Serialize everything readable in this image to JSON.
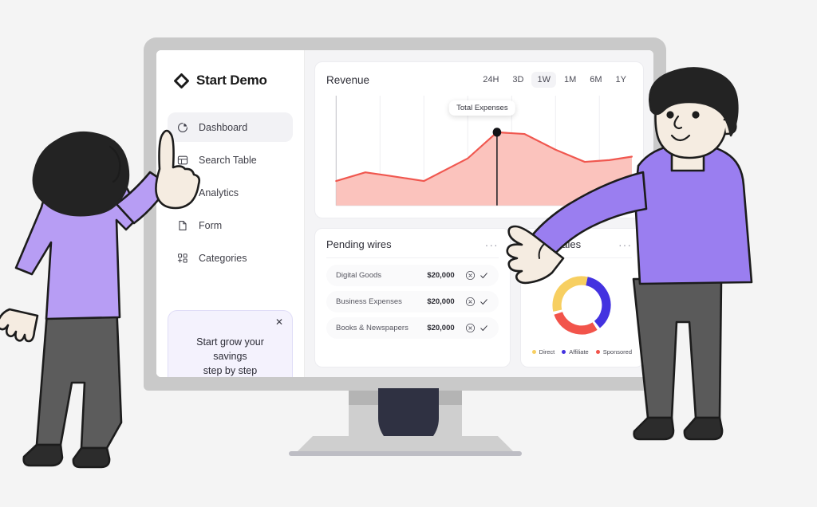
{
  "app": {
    "brand_name": "Start Demo",
    "brand_logo_icon": "diamond-outline-icon"
  },
  "sidebar": {
    "items": [
      {
        "label": "Dashboard",
        "icon": "pie-chart-icon",
        "active": true
      },
      {
        "label": "Search Table",
        "icon": "table-icon",
        "active": false
      },
      {
        "label": "Analytics",
        "icon": "bar-chart-icon",
        "active": false
      },
      {
        "label": "Form",
        "icon": "document-icon",
        "active": false
      },
      {
        "label": "Categories",
        "icon": "grid-plus-icon",
        "active": false
      }
    ],
    "promo": {
      "line1": "Start grow your savings",
      "line2": "step by step",
      "close_label": "✕",
      "close_icon": "close-icon"
    }
  },
  "revenue": {
    "title": "Revenue",
    "ranges": [
      "24H",
      "3D",
      "1W",
      "1M",
      "6M",
      "1Y"
    ],
    "selected_range": "1W",
    "tooltip_label": "Total Expenses"
  },
  "pending_wires": {
    "title": "Pending wires",
    "menu_icon": "ellipsis-icon",
    "menu_label": "···",
    "rows": [
      {
        "name": "Digital Goods",
        "amount": "$20,000",
        "reject_icon": "x-circle-icon",
        "accept_icon": "check-icon"
      },
      {
        "name": "Business Expenses",
        "amount": "$20,000",
        "reject_icon": "x-circle-icon",
        "accept_icon": "check-icon"
      },
      {
        "name": "Books & Newspapers",
        "amount": "$20,000",
        "reject_icon": "x-circle-icon",
        "accept_icon": "check-icon"
      }
    ]
  },
  "total_sales": {
    "title": "Total sales",
    "menu_icon": "ellipsis-icon",
    "menu_label": "···",
    "legend": [
      {
        "label": "Direct",
        "color": "#f7cf61"
      },
      {
        "label": "Affiliate",
        "color": "#4332e0"
      },
      {
        "label": "Sponsored",
        "color": "#f2544b"
      }
    ]
  },
  "colors": {
    "background": "#f4f4f4",
    "bezel": "#c9c9c9",
    "sweater_purple": "#b79df4",
    "sweater_purple_dark": "#9a7ef0",
    "hair_black": "#232323",
    "pants_gray": "#5c5c5c",
    "pants_gray_dark": "#4f4f4f",
    "skin": "#f5ece1",
    "chart_red": "#f0574f",
    "chart_red_fill": "#fbc3bd"
  },
  "chart_data": [
    {
      "type": "area",
      "title": "Revenue",
      "series": [
        {
          "name": "Total Expenses",
          "x": [
            0,
            1,
            2,
            3,
            4,
            5,
            6,
            7,
            8,
            9,
            10
          ],
          "values": [
            26,
            38,
            24,
            46,
            68,
            88,
            85,
            60,
            40,
            34,
            42
          ]
        }
      ],
      "xlabel": "",
      "ylabel": "",
      "ylim": [
        0,
        100
      ],
      "grid": true,
      "gridlines_x": 7,
      "legend": false,
      "annotations": [
        {
          "label": "Total Expenses",
          "x": 5,
          "y": 88,
          "marker": "dot",
          "vertical_line": true
        }
      ],
      "fill_color": "#fbc3bd",
      "line_color": "#f0574f"
    },
    {
      "type": "pie",
      "title": "Total sales",
      "donut": true,
      "labels": [
        "Direct",
        "Affiliate",
        "Sponsored"
      ],
      "values": [
        34,
        36,
        30
      ],
      "colors": [
        "#f7cf61",
        "#4332e0",
        "#f2544b"
      ],
      "legend": true,
      "legend_position": "bottom"
    }
  ]
}
